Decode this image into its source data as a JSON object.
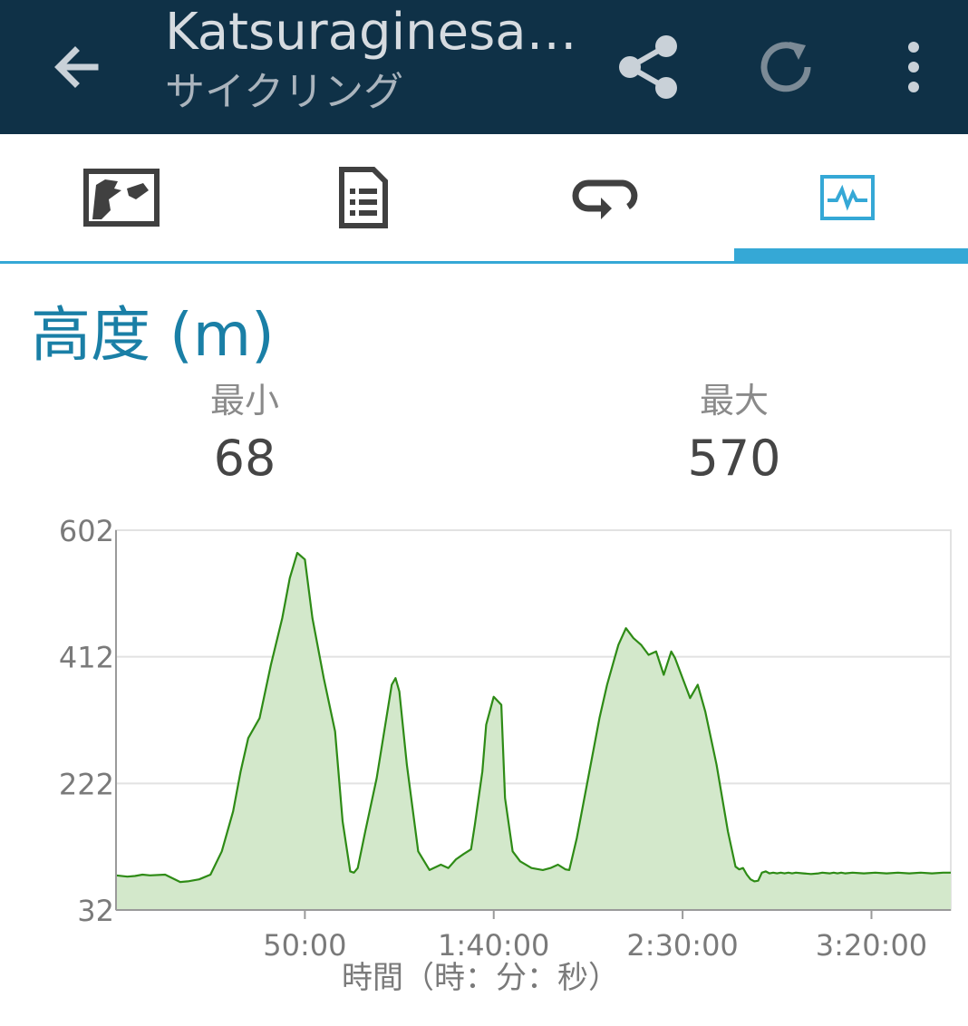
{
  "app_bar": {
    "title": "Katsuraginesa…",
    "subtitle": "サイクリング",
    "icons": [
      "arrow-left-icon",
      "share-icon",
      "refresh-icon",
      "more-vert-icon"
    ],
    "background": "#0f3147"
  },
  "tabs": [
    {
      "icon": "map-icon",
      "selected": false
    },
    {
      "icon": "details-document-icon",
      "selected": false
    },
    {
      "icon": "laps-loop-icon",
      "selected": false
    },
    {
      "icon": "chart-icon",
      "selected": true
    }
  ],
  "accent_color": "#35a8d6",
  "section": {
    "title": "高度 (m)",
    "min_label": "最小",
    "min_value": "68",
    "max_label": "最大",
    "max_value": "570"
  },
  "chart_data": {
    "type": "area",
    "title": "",
    "xlabel": "時間（時：分：秒）",
    "ylabel": "",
    "ylim": [
      32,
      602
    ],
    "y_ticks": [
      32,
      222,
      412,
      602
    ],
    "y_tick_labels": [
      "32",
      "222",
      "412",
      "602"
    ],
    "x_ticks_min": [
      50,
      100,
      150,
      200
    ],
    "x_tick_labels": [
      "50:00",
      "1:40:00",
      "2:30:00",
      "3:20:00"
    ],
    "xlim_min": [
      0,
      221
    ],
    "x_min": [
      0,
      3,
      5,
      7,
      9,
      13,
      17,
      19,
      20,
      22,
      25,
      28,
      31,
      33,
      35,
      38,
      41,
      44,
      46,
      48,
      50,
      52,
      55,
      58,
      60,
      62,
      63,
      64,
      66,
      69,
      71,
      73,
      74,
      75,
      77,
      80,
      83,
      86,
      88,
      90,
      92,
      94,
      95,
      97,
      98,
      100,
      102,
      103,
      105,
      107,
      110,
      113,
      115,
      117,
      119,
      120,
      122,
      125,
      128,
      130,
      132,
      133,
      135,
      137,
      139,
      141,
      143,
      145,
      147,
      148,
      150,
      152,
      154,
      156,
      159,
      162,
      164,
      165,
      166,
      167,
      168,
      169,
      170,
      171,
      172,
      173,
      174,
      175,
      176,
      177,
      178,
      179,
      180,
      182,
      184,
      186,
      187,
      189,
      190,
      191,
      192,
      193,
      195,
      198,
      201,
      204,
      207,
      210,
      213,
      216,
      219,
      221
    ],
    "series": [
      {
        "color": "#2e8b16",
        "fill": "#d3e8cb",
        "values": [
          84,
          82,
          83,
          85,
          84,
          85,
          74,
          75,
          76,
          78,
          85,
          120,
          180,
          240,
          290,
          320,
          400,
          470,
          530,
          568,
          558,
          470,
          380,
          300,
          165,
          90,
          88,
          95,
          150,
          230,
          300,
          370,
          380,
          360,
          250,
          120,
          92,
          100,
          95,
          108,
          116,
          123,
          160,
          240,
          310,
          352,
          340,
          200,
          120,
          105,
          95,
          92,
          95,
          100,
          93,
          92,
          140,
          230,
          320,
          370,
          410,
          430,
          455,
          440,
          430,
          415,
          420,
          385,
          420,
          410,
          380,
          350,
          370,
          330,
          250,
          150,
          97,
          93,
          95,
          85,
          78,
          75,
          76,
          88,
          90,
          87,
          88,
          87,
          88,
          87,
          88,
          87,
          88,
          87,
          86,
          87,
          88,
          87,
          88,
          87,
          88,
          87,
          88,
          87,
          88,
          87,
          88,
          87,
          88,
          87,
          88,
          88
        ]
      }
    ],
    "grid": true,
    "legend": "none"
  }
}
